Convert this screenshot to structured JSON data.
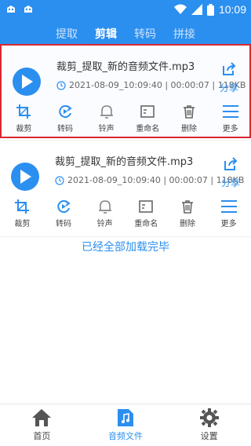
{
  "statusbar": {
    "time": "10:09",
    "battery": "100"
  },
  "tabs": [
    {
      "label": "提取",
      "active": false
    },
    {
      "label": "剪辑",
      "active": true
    },
    {
      "label": "转码",
      "active": false
    },
    {
      "label": "拼接",
      "active": false
    }
  ],
  "files": [
    {
      "title": "裁剪_提取_新的音频文件.mp3",
      "meta": "2021-08-09_10:09:40 | 00:00:07 | 118KB",
      "share_label": "分享",
      "selected": true
    },
    {
      "title": "裁剪_提取_新的音频文件.mp3",
      "meta": "2021-08-09_10:09:40 | 00:00:07 | 118KB",
      "share_label": "分享",
      "selected": false
    }
  ],
  "actions": [
    "裁剪",
    "转码",
    "铃声",
    "重命名",
    "删除",
    "更多"
  ],
  "status_message": "已经全部加载完毕",
  "bottom_nav": [
    {
      "label": "首页",
      "icon": "home-icon",
      "active": false
    },
    {
      "label": "音频文件",
      "icon": "music-file-icon",
      "active": true
    },
    {
      "label": "设置",
      "icon": "gear-icon",
      "active": false
    }
  ],
  "colors": {
    "primary": "#2b8ff0",
    "selection_border": "#d8282f",
    "text": "#333333"
  }
}
